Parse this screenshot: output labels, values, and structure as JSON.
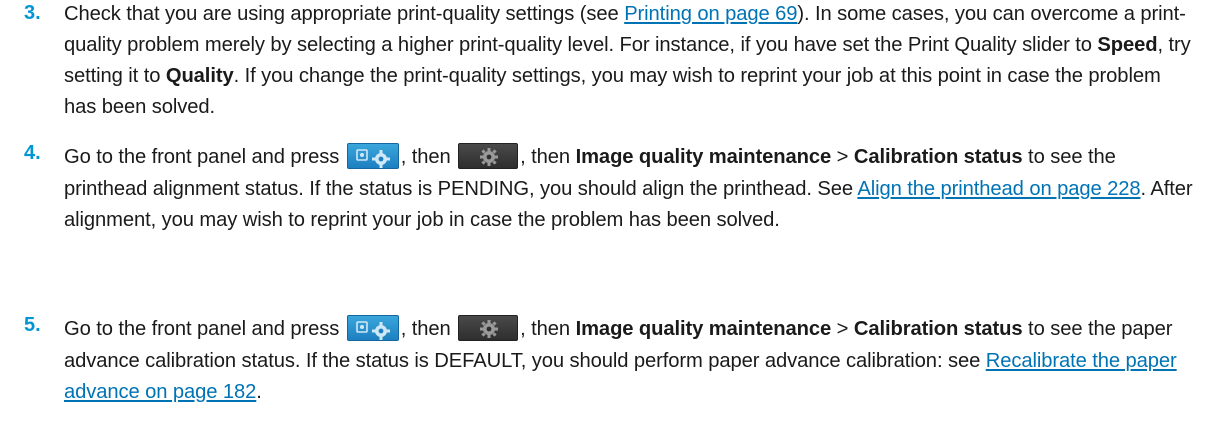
{
  "steps": [
    {
      "number": "3.",
      "text_1": "Check that you are using appropriate print-quality settings (see ",
      "link_1": "Printing on page 69",
      "text_2": "). In some cases, you can overcome a print-quality problem merely by selecting a higher print-quality level. For instance, if you have set the Print Quality slider to ",
      "bold_1": "Speed",
      "text_3": ", try setting it to ",
      "bold_2": "Quality",
      "text_4": ". If you change the print-quality settings, you may wish to reprint your job at this point in case the problem has been solved."
    },
    {
      "number": "4.",
      "text_1": "Go to the front panel and press ",
      "text_2": ", then ",
      "text_3": ", then ",
      "bold_1": "Image quality maintenance",
      "text_4": " > ",
      "bold_2": "Calibration status",
      "text_5": " to see the printhead alignment status. If the status is PENDING, you should align the printhead. See ",
      "link_1": "Align the printhead on page 228",
      "text_6": ". After alignment, you may wish to reprint your job in case the problem has been solved."
    },
    {
      "number": "5.",
      "text_1": "Go to the front panel and press ",
      "text_2": ", then ",
      "text_3": ", then ",
      "bold_1": "Image quality maintenance",
      "text_4": " > ",
      "bold_2": "Calibration status",
      "text_5": " to see the paper advance calibration status. If the status is DEFAULT, you should perform paper advance calibration: see ",
      "link_1": "Recalibrate the paper advance on page 182",
      "text_6": "."
    }
  ],
  "icons": {
    "first": "settings-icon",
    "second": "gear-icon"
  },
  "colors": {
    "step_number": "#0096d6",
    "link": "#0073b5",
    "settings_button": "#1d7fc0",
    "gear_button": "#2e2e2e"
  }
}
